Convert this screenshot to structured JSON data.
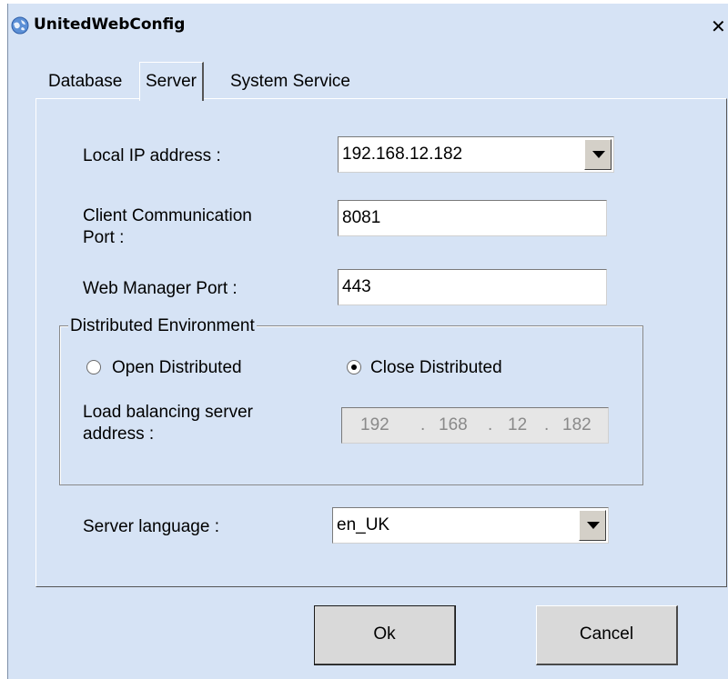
{
  "window": {
    "title": "UnitedWebConfig",
    "close_glyph": "✕",
    "icon": "globe-icon"
  },
  "tabs": [
    {
      "label": "Database",
      "active": false
    },
    {
      "label": "Server",
      "active": true
    },
    {
      "label": "System Service",
      "active": false
    }
  ],
  "server": {
    "local_ip_label": "Local IP address :",
    "local_ip_value": "192.168.12.182",
    "client_port_label_line1": "Client Communication",
    "client_port_label_line2": "Port :",
    "client_port_value": "8081",
    "web_port_label": "Web Manager Port :",
    "web_port_value": "443",
    "distributed": {
      "group_title": "Distributed Environment",
      "open_label": "Open Distributed",
      "close_label": "Close Distributed",
      "selected": "Close Distributed",
      "lb_label_line1": "Load balancing server",
      "lb_label_line2": "address :",
      "lb_ip": [
        "192",
        "168",
        "12",
        "182"
      ],
      "lb_dot": "."
    },
    "language_label": "Server language :",
    "language_value": "en_UK"
  },
  "buttons": {
    "ok": "Ok",
    "cancel": "Cancel"
  }
}
